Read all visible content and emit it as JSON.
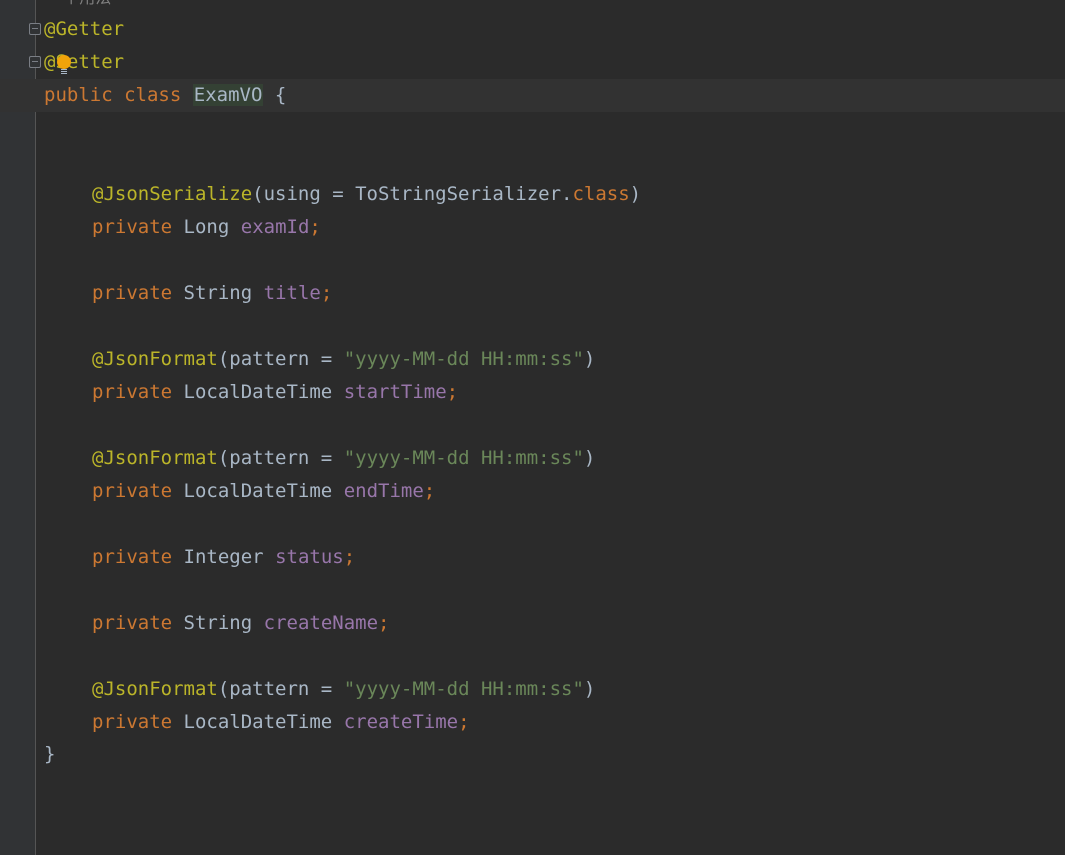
{
  "top_comment": "* 个用法",
  "annotations": {
    "getter": "@Getter",
    "setter": "@Setter",
    "json_serialize": "@JsonSerialize",
    "json_format": "@JsonFormat"
  },
  "class_decl": {
    "public": "public",
    "class": "class",
    "name": "ExamVO",
    "open_brace": "{",
    "close_brace": "}"
  },
  "serialize_args": {
    "open": "(using = ToStringSerializer.",
    "kw": "class",
    "close": ")"
  },
  "format_args": {
    "open": "(pattern = ",
    "pattern": "\"yyyy-MM-dd HH:mm:ss\"",
    "close": ")"
  },
  "fields": [
    {
      "modifier": "private",
      "type": "Long",
      "name": "examId",
      "semi": ";"
    },
    {
      "modifier": "private",
      "type": "String",
      "name": "title",
      "semi": ";"
    },
    {
      "modifier": "private",
      "type": "LocalDateTime",
      "name": "startTime",
      "semi": ";"
    },
    {
      "modifier": "private",
      "type": "LocalDateTime",
      "name": "endTime",
      "semi": ";"
    },
    {
      "modifier": "private",
      "type": "Integer",
      "name": "status",
      "semi": ";"
    },
    {
      "modifier": "private",
      "type": "String",
      "name": "createName",
      "semi": ";"
    },
    {
      "modifier": "private",
      "type": "LocalDateTime",
      "name": "createTime",
      "semi": ";"
    }
  ],
  "colors": {
    "background": "#2b2b2b",
    "keyword": "#cc7832",
    "annotation": "#bbb529",
    "field": "#9876aa",
    "string": "#6a8759",
    "plain": "#a9b7c6"
  },
  "icons": {
    "fold": "fold-marker-icon",
    "intention": "lightbulb-icon"
  }
}
